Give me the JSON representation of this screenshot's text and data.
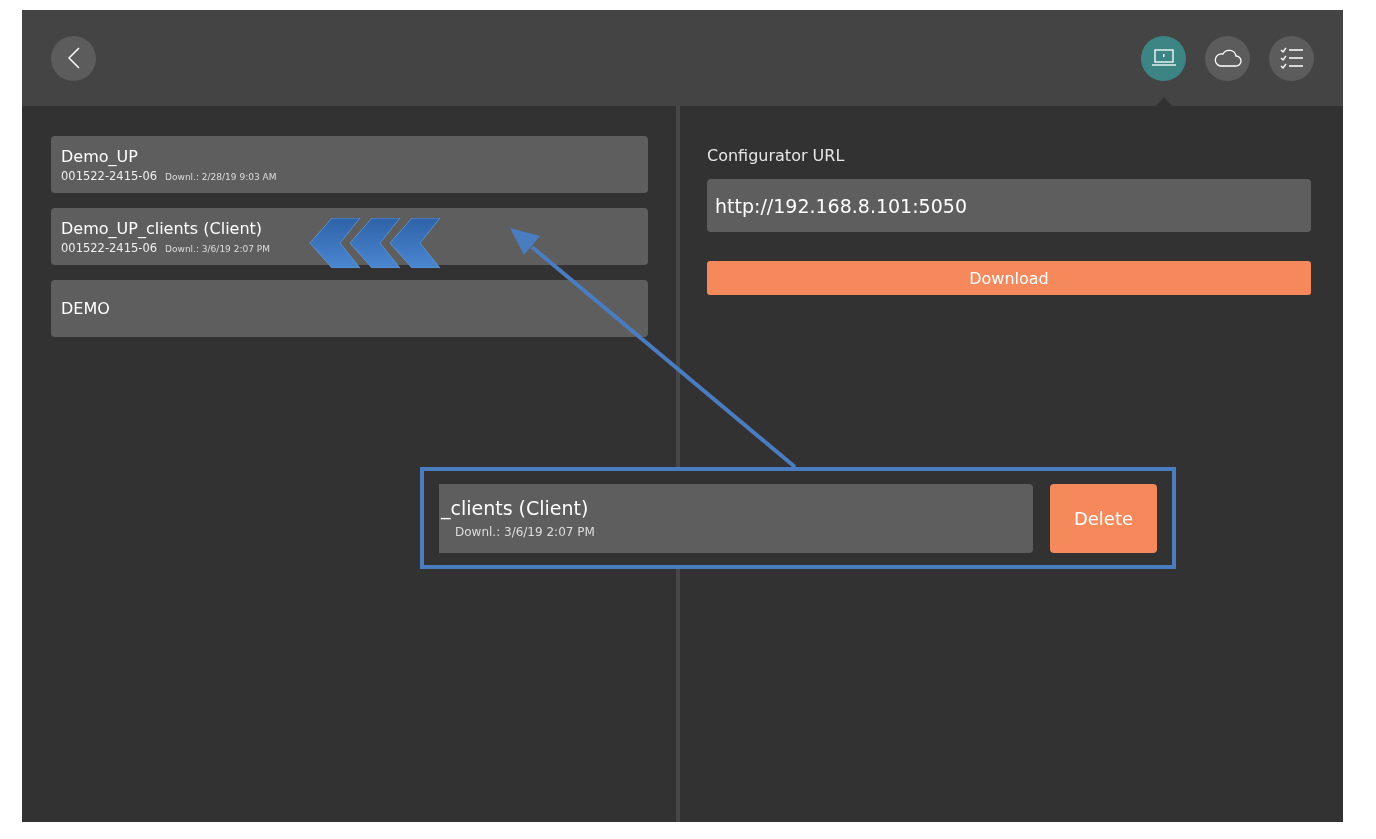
{
  "header": {
    "modes": [
      {
        "kind": "laptop",
        "selected": true
      },
      {
        "kind": "cloud",
        "selected": false
      },
      {
        "kind": "checklist",
        "selected": false
      }
    ]
  },
  "configurations": [
    {
      "name": "Demo_UP",
      "serial": "001522-2415-06",
      "downloaded": "Downl.: 2/28/19 9:03 AM"
    },
    {
      "name": "Demo_UP_clients (Client)",
      "serial": "001522-2415-06",
      "downloaded": "Downl.: 3/6/19 2:07 PM"
    },
    {
      "name": "DEMO"
    }
  ],
  "configurator": {
    "label": "Configurator URL",
    "value": "http://192.168.8.101:5050",
    "button": "Download"
  },
  "annotation": {
    "swiped_row": {
      "name": "_clients (Client)",
      "downloaded": "Downl.: 3/6/19 2:07 PM"
    },
    "action": "Delete"
  }
}
